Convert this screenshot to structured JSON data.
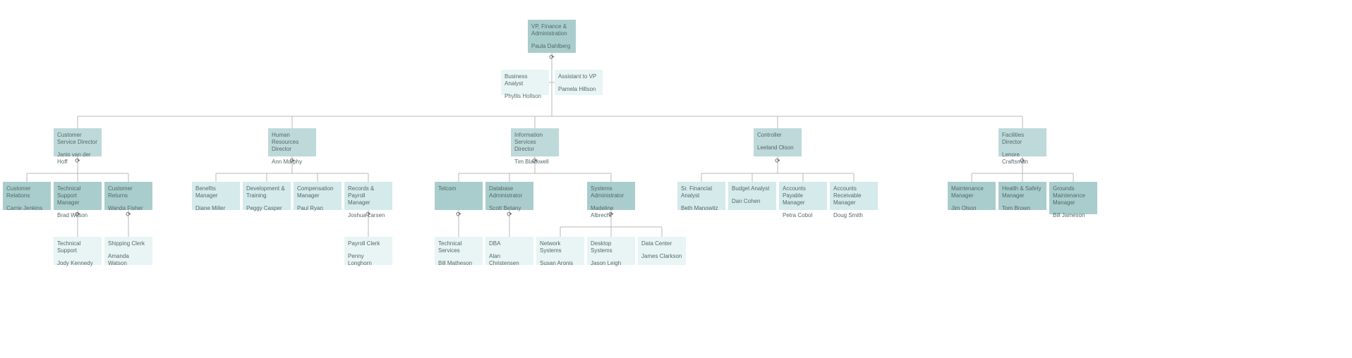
{
  "chart_data": {
    "type": "org_chart",
    "root": {
      "title": "VP, Finance & Administration",
      "name": "Paula Dahlberg",
      "assistants": [
        {
          "title": "Business Analyst",
          "name": "Phyllis Hollson"
        },
        {
          "title": "Assistant to VP",
          "name": "Pamela Hillson"
        }
      ],
      "children": [
        {
          "title": "Customer Service Director",
          "name": "Janis van der Hoff",
          "children": [
            {
              "title": "Customer Relations",
              "name": "Carrie Jenkins"
            },
            {
              "title": "Technical Support Manager",
              "name": "Brad Wilson",
              "children": [
                {
                  "title": "Technical Support",
                  "name": "Jody Kennedy"
                }
              ]
            },
            {
              "title": "Customer Returns",
              "name": "Wanda Fisher",
              "children": [
                {
                  "title": "Shipping Clerk",
                  "name": "Amanda Watson"
                }
              ]
            }
          ]
        },
        {
          "title": "Human Resources Director",
          "name": "Ann Murphy",
          "children": [
            {
              "title": "Benefits Manager",
              "name": "Diane Miller"
            },
            {
              "title": "Development & Training",
              "name": "Peggy Casper"
            },
            {
              "title": "Compensation Manager",
              "name": "Paul Ryan"
            },
            {
              "title": "Records & Payroll Manager",
              "name": "Joshua Larsen",
              "children": [
                {
                  "title": "Payroll Clerk",
                  "name": "Penny Longhorn"
                }
              ]
            }
          ]
        },
        {
          "title": "Information Services Director",
          "name": "Tim Blackwell",
          "children": [
            {
              "title": "Telcom",
              "name": "",
              "children": [
                {
                  "title": "Technical Services",
                  "name": "Bill Matheson"
                }
              ]
            },
            {
              "title": "Database Administrator",
              "name": "Scott Betany",
              "children": [
                {
                  "title": "DBA",
                  "name": "Alan Christensen"
                }
              ]
            },
            {
              "title": "Systems Administrator",
              "name": "Madeline Albrecht",
              "children": [
                {
                  "title": "Network Systems",
                  "name": "Susan Aronis"
                },
                {
                  "title": "Desktop Systems",
                  "name": "Jason Leigh"
                },
                {
                  "title": "Data Center",
                  "name": "James Clarkson"
                }
              ]
            }
          ]
        },
        {
          "title": "Controller",
          "name": "Leeland Olson",
          "children": [
            {
              "title": "Sr. Financial Analyst",
              "name": "Beth Manowitz"
            },
            {
              "title": "Budget Analyst",
              "name": "Dan Cohen"
            },
            {
              "title": "Accounts Payable Manager",
              "name": "Petra Cobol"
            },
            {
              "title": "Accounts Receivable Manager",
              "name": "Doug Smith"
            }
          ]
        },
        {
          "title": "Facilities Director",
          "name": "Lenore Craftsman",
          "children": [
            {
              "title": "Maintenance Manager",
              "name": "Jim Olson"
            },
            {
              "title": "Health & Safety Manager",
              "name": "Tom Brown"
            },
            {
              "title": "Grounds Maintenance Manager",
              "name": "Bill Jameson"
            }
          ]
        }
      ]
    }
  },
  "nodes": {
    "vp": {
      "title": "VP, Finance & Administration",
      "name": "Paula Dahlberg"
    },
    "ba": {
      "title": "Business Analyst",
      "name": "Phyllis Hollson"
    },
    "avp": {
      "title": "Assistant to VP",
      "name": "Pamela Hillson"
    },
    "csd": {
      "title": "Customer Service Director",
      "name": "Janis van der Hoff"
    },
    "cr": {
      "title": "Customer Relations",
      "name": "Carrie Jenkins"
    },
    "tsm": {
      "title": "Technical Support Manager",
      "name": "Brad Wilson"
    },
    "cret": {
      "title": "Customer Returns",
      "name": "Wanda Fisher"
    },
    "ts": {
      "title": "Technical Support",
      "name": "Jody Kennedy"
    },
    "sc": {
      "title": "Shipping Clerk",
      "name": "Amanda Watson"
    },
    "hrd": {
      "title": "Human Resources Director",
      "name": "Ann Murphy"
    },
    "bm": {
      "title": "Benefits Manager",
      "name": "Diane Miller"
    },
    "dt": {
      "title": "Development & Training",
      "name": "Peggy Casper"
    },
    "cm": {
      "title": "Compensation Manager",
      "name": "Paul Ryan"
    },
    "rpm": {
      "title": "Records & Payroll Manager",
      "name": "Joshua Larsen"
    },
    "pc": {
      "title": "Payroll Clerk",
      "name": "Penny Longhorn"
    },
    "isd": {
      "title": "Information Services Director",
      "name": "Tim Blackwell"
    },
    "tel": {
      "title": "Telcom",
      "name": ""
    },
    "dba_a": {
      "title": "Database Administrator",
      "name": "Scott Betany"
    },
    "sa": {
      "title": "Systems Administrator",
      "name": "Madeline Albrecht"
    },
    "tsv": {
      "title": "Technical Services",
      "name": "Bill Matheson"
    },
    "dba": {
      "title": "DBA",
      "name": "Alan Christensen"
    },
    "ns": {
      "title": "Network Systems",
      "name": "Susan Aronis"
    },
    "ds": {
      "title": "Desktop Systems",
      "name": "Jason Leigh"
    },
    "dc": {
      "title": "Data Center",
      "name": "James Clarkson"
    },
    "ctrl": {
      "title": "Controller",
      "name": "Leeland Olson"
    },
    "sfa": {
      "title": "Sr. Financial Analyst",
      "name": "Beth Manowitz"
    },
    "bua": {
      "title": "Budget Analyst",
      "name": "Dan Cohen"
    },
    "apm": {
      "title": "Accounts Payable Manager",
      "name": "Petra Cobol"
    },
    "arm": {
      "title": "Accounts Receivable Manager",
      "name": "Doug Smith"
    },
    "fac": {
      "title": "Facilities Director",
      "name": "Lenore Craftsman"
    },
    "mm": {
      "title": "Maintenance Manager",
      "name": "Jim Olson"
    },
    "hsm": {
      "title": "Health & Safety Manager",
      "name": "Tom Brown"
    },
    "gmm": {
      "title": "Grounds Maintenance Manager",
      "name": "Bill Jameson"
    }
  },
  "expand_icon": "⟳"
}
